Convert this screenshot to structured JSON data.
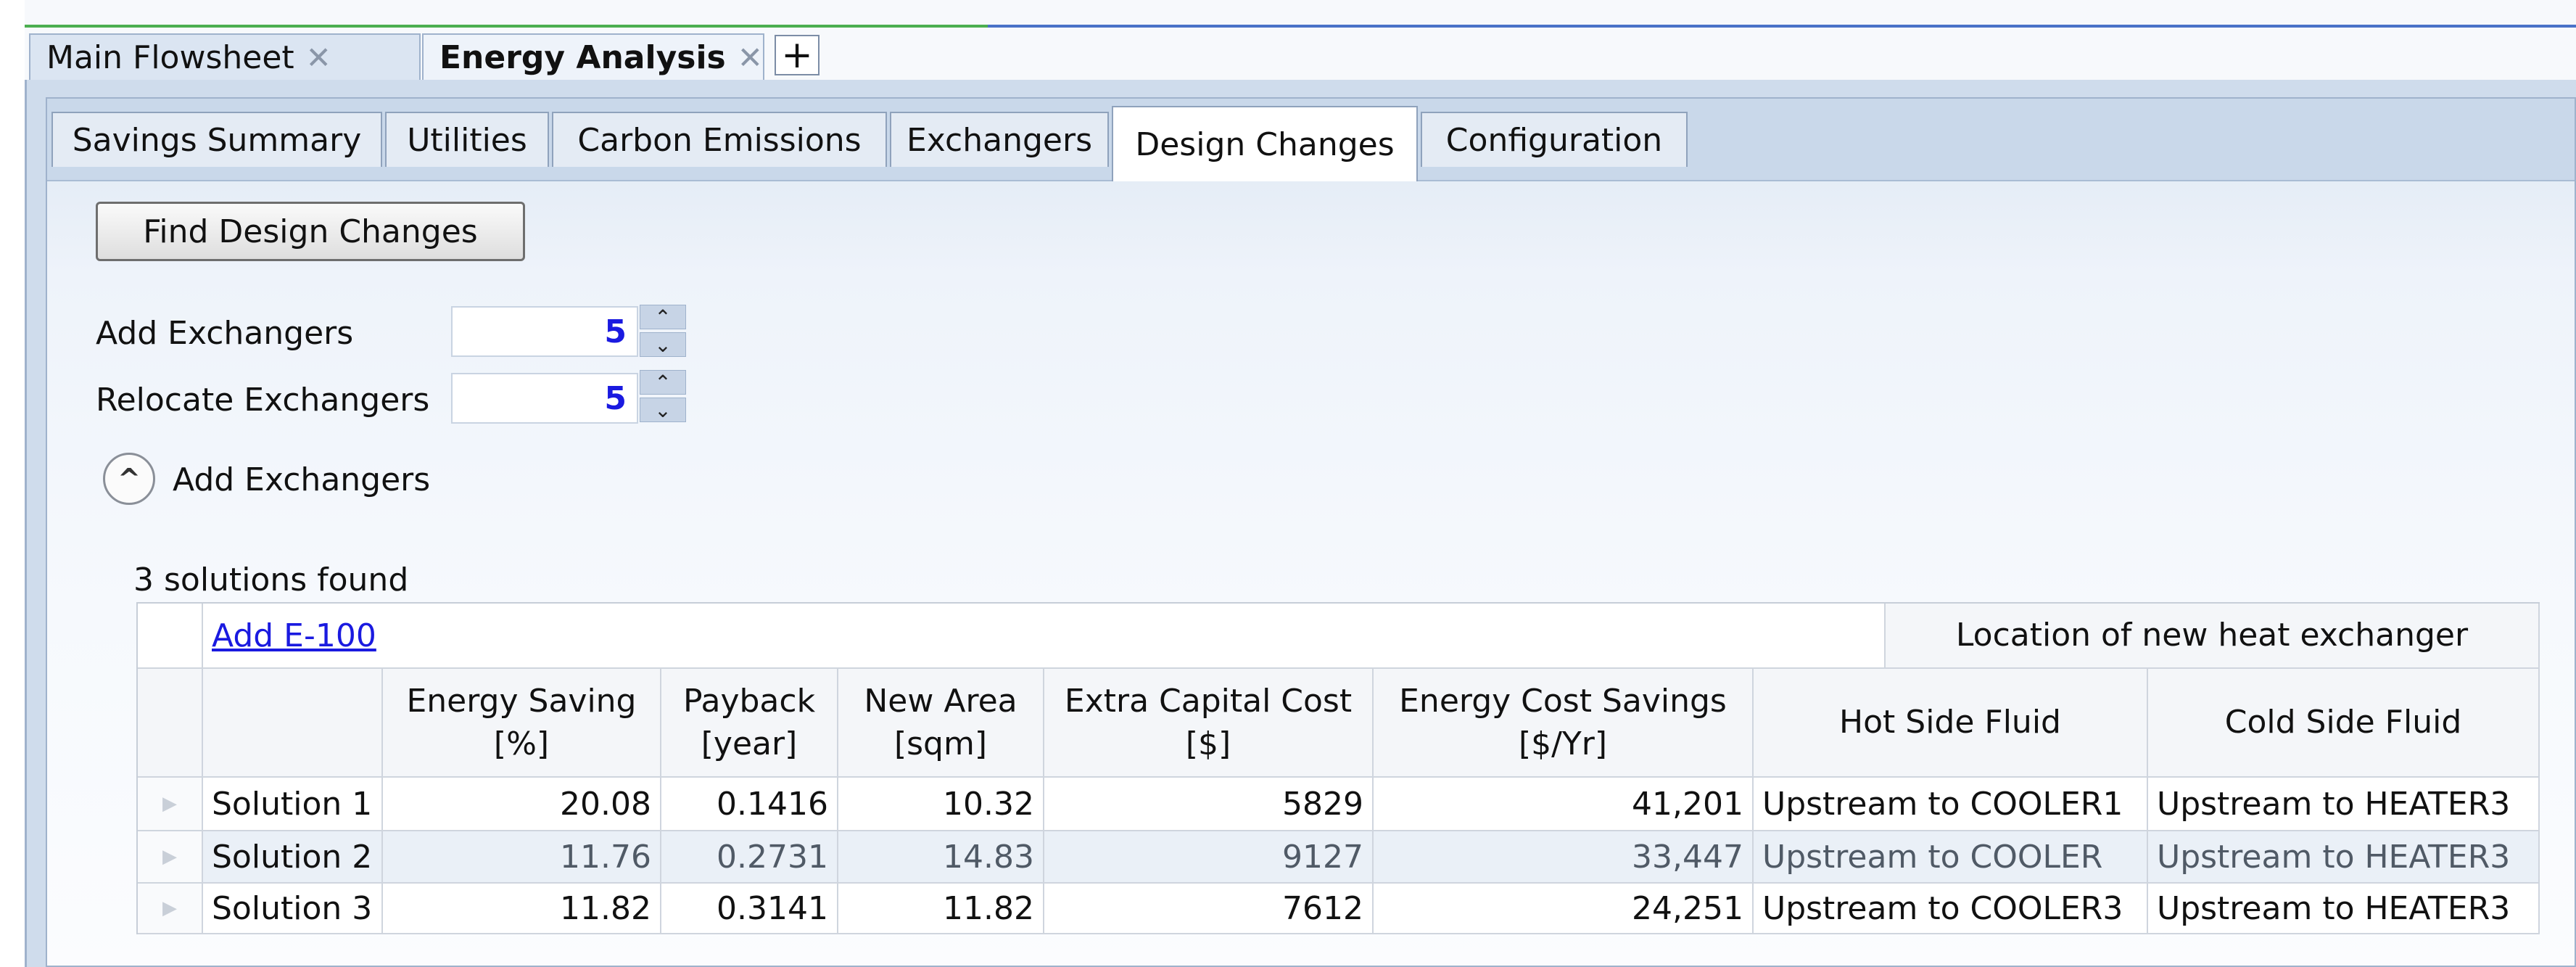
{
  "doc_tabs": [
    {
      "label": "Main Flowsheet",
      "active": false
    },
    {
      "label": "Energy Analysis",
      "active": true
    }
  ],
  "sub_tabs": [
    "Savings Summary",
    "Utilities",
    "Carbon Emissions",
    "Exchangers",
    "Design Changes",
    "Configuration"
  ],
  "selected_sub_tab": "Design Changes",
  "find_button": "Find Design Changes",
  "add_exchangers": {
    "label": "Add Exchangers",
    "value": "5"
  },
  "relocate_exchangers": {
    "label": "Relocate Exchangers",
    "value": "5"
  },
  "section_title": "Add Exchangers",
  "solutions_found": "3 solutions found",
  "table": {
    "link_label": "Add E-100",
    "group_header": "Location of new heat exchanger",
    "columns": [
      {
        "title": "Energy Saving",
        "unit": "[%]"
      },
      {
        "title": "Payback",
        "unit": "[year]"
      },
      {
        "title": "New Area",
        "unit": "[sqm]"
      },
      {
        "title": "Extra Capital Cost",
        "unit": "[$]"
      },
      {
        "title": "Energy Cost Savings",
        "unit": "[$/Yr]"
      },
      {
        "title": "Hot Side Fluid",
        "unit": ""
      },
      {
        "title": "Cold Side Fluid",
        "unit": ""
      }
    ],
    "rows": [
      {
        "name": "Solution 1",
        "energy_saving": "20.08",
        "payback": "0.1416",
        "new_area": "10.32",
        "capital_cost": "5829",
        "cost_savings": "41,201",
        "hot_side": "Upstream to COOLER1",
        "cold_side": "Upstream to HEATER3"
      },
      {
        "name": "Solution 2",
        "energy_saving": "11.76",
        "payback": "0.2731",
        "new_area": "14.83",
        "capital_cost": "9127",
        "cost_savings": "33,447",
        "hot_side": "Upstream to COOLER",
        "cold_side": "Upstream to HEATER3"
      },
      {
        "name": "Solution 3",
        "energy_saving": "11.82",
        "payback": "0.3141",
        "new_area": "11.82",
        "capital_cost": "7612",
        "cost_savings": "24,251",
        "hot_side": "Upstream to COOLER3",
        "cold_side": "Upstream to HEATER3"
      }
    ]
  },
  "colors": {
    "accent_green": "#4caf50",
    "accent_blue": "#4a72c8",
    "link": "#1a1ae0"
  }
}
